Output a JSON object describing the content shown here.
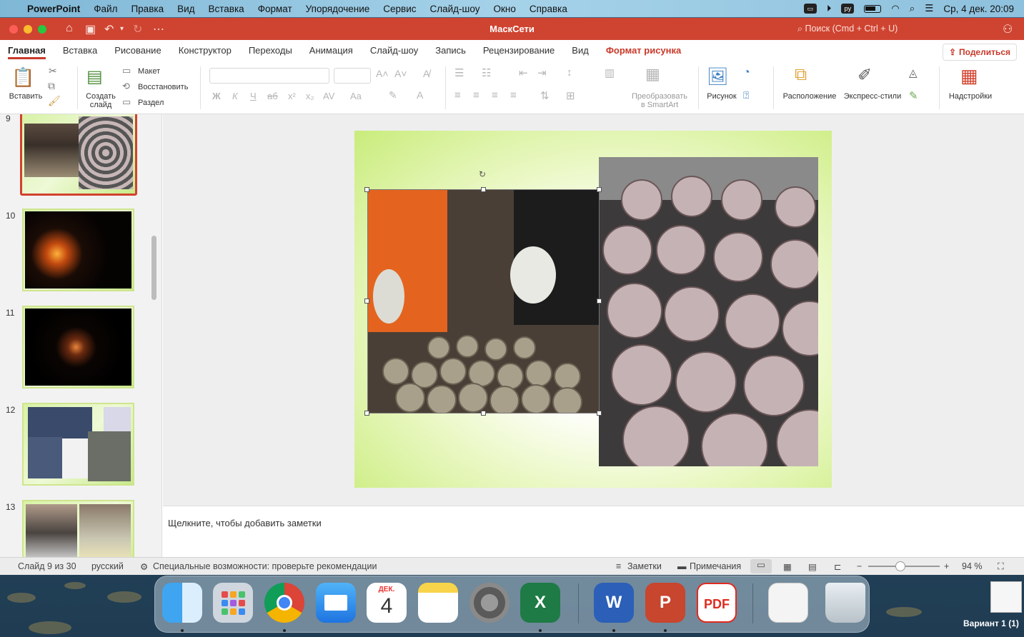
{
  "menubar": {
    "app_name": "PowerPoint",
    "items": [
      "Файл",
      "Правка",
      "Вид",
      "Вставка",
      "Формат",
      "Упорядочение",
      "Сервис",
      "Слайд-шоу",
      "Окно",
      "Справка"
    ],
    "clock": "Ср, 4 дек.  20:09",
    "icons": [
      "apple-icon",
      "display-icon",
      "play-icon",
      "py-icon",
      "battery-icon",
      "wifi-icon",
      "search-icon",
      "control-center-icon"
    ]
  },
  "titlebar": {
    "title": "МаскСети",
    "search_placeholder": "Поиск (Cmd + Ctrl + U)"
  },
  "ribbon_tabs": [
    {
      "label": "Главная",
      "active": true
    },
    {
      "label": "Вставка"
    },
    {
      "label": "Рисование"
    },
    {
      "label": "Конструктор"
    },
    {
      "label": "Переходы"
    },
    {
      "label": "Анимация"
    },
    {
      "label": "Слайд-шоу"
    },
    {
      "label": "Запись"
    },
    {
      "label": "Рецензирование"
    },
    {
      "label": "Вид"
    },
    {
      "label": "Формат рисунка",
      "contextual": true
    }
  ],
  "share_label": "Поделиться",
  "ribbon": {
    "paste": "Вставить",
    "new_slide_1": "Создать",
    "new_slide_2": "слайд",
    "layout": "Макет",
    "reset": "Восстановить",
    "section": "Раздел",
    "smartart_1": "Преобразовать",
    "smartart_2": "в SmartArt",
    "picture": "Рисунок",
    "arrange": "Расположение",
    "quick_styles": "Экспресс-стили",
    "addins": "Надстройки"
  },
  "thumbnails": [
    {
      "num": "9",
      "selected": true
    },
    {
      "num": "10"
    },
    {
      "num": "11"
    },
    {
      "num": "12"
    },
    {
      "num": "13"
    }
  ],
  "notes_placeholder": "Щелкните, чтобы добавить заметки",
  "status": {
    "slide_info": "Слайд 9 из 30",
    "language": "русский",
    "accessibility": "Специальные возможности: проверьте рекомендации",
    "notes": "Заметки",
    "comments": "Примечания",
    "zoom": "94 %",
    "zoom_level": 0.94
  },
  "dock": {
    "calendar_month": "ДЕК.",
    "calendar_day": "4",
    "apps": [
      "finder",
      "launchpad",
      "chrome",
      "mail",
      "calendar",
      "notes",
      "system-settings",
      "excel",
      "word",
      "powerpoint",
      "pdf",
      "document-preview",
      "trash"
    ]
  },
  "desktop_label": "Вариант 1 (1)",
  "colors": {
    "accent": "#c8392a",
    "titlebar": "#cf4431",
    "slide_green": "#c9ec7b"
  }
}
